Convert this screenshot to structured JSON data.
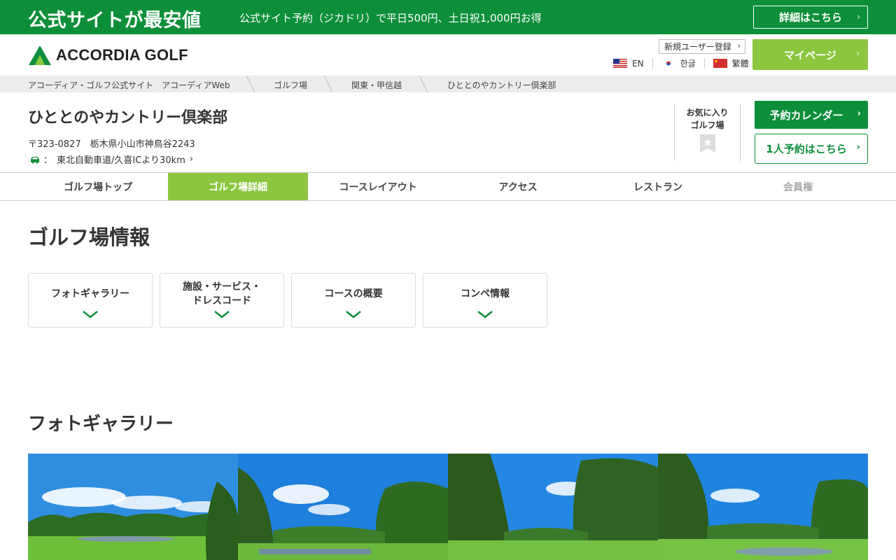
{
  "promo": {
    "title": "公式サイトが最安値",
    "text": "公式サイト予約（ジカドリ）で平日500円、土日祝1,000円お得",
    "button": "詳細はこちら"
  },
  "header": {
    "logo_text": "ACCORDIA GOLF",
    "signup": "新規ユーザー登録",
    "languages": [
      "EN",
      "한글",
      "繁體"
    ],
    "mypage": "マイページ"
  },
  "breadcrumb": [
    "アコーディア・ゴルフ公式サイト　アコーディアWeb",
    "ゴルフ場",
    "関東・甲信越",
    "ひととのやカントリー倶楽部"
  ],
  "club": {
    "name": "ひととのやカントリー倶楽部",
    "address": "〒323-0827　栃木県小山市神鳥谷2243",
    "access_sep": "：",
    "access": "東北自動車道/久喜ICより30km",
    "favorite_line1": "お気に入り",
    "favorite_line2": "ゴルフ場",
    "calendar_button": "予約カレンダー",
    "single_button": "1人予約はこちら"
  },
  "tabs": [
    "ゴルフ場トップ",
    "ゴルフ場詳細",
    "コースレイアウト",
    "アクセス",
    "レストラン",
    "会員権"
  ],
  "info": {
    "title": "ゴルフ場情報",
    "cards": [
      {
        "line1": "フォトギャラリー",
        "line2": ""
      },
      {
        "line1": "施設・サービス・",
        "line2": "ドレスコード"
      },
      {
        "line1": "コースの概要",
        "line2": ""
      },
      {
        "line1": "コンペ情報",
        "line2": ""
      }
    ]
  },
  "gallery": {
    "title": "フォトギャラリー"
  },
  "colors": {
    "brand_green": "#0d8f3a",
    "accent_green": "#8cc63f"
  }
}
